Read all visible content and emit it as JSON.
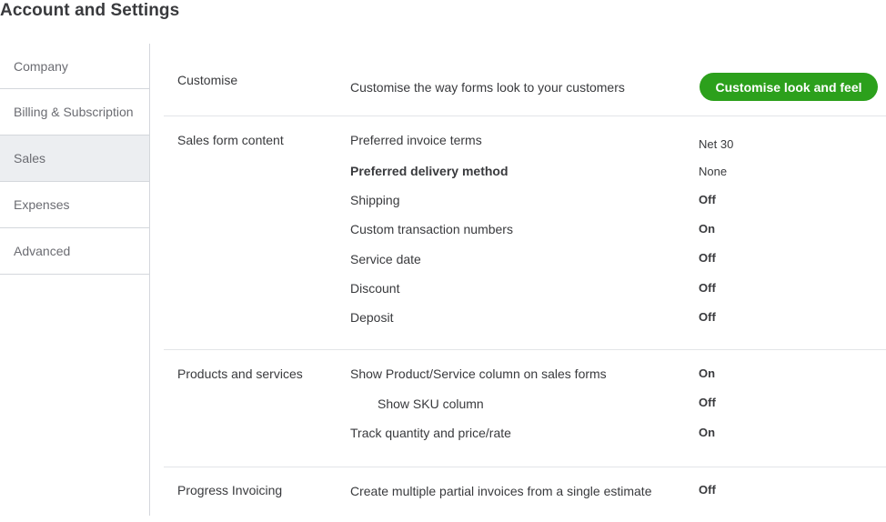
{
  "header": {
    "title": "Account and Settings"
  },
  "sidebar": {
    "items": [
      {
        "label": "Company"
      },
      {
        "label": "Billing & Subscription"
      },
      {
        "label": "Sales",
        "active": true
      },
      {
        "label": "Expenses"
      },
      {
        "label": "Advanced"
      }
    ]
  },
  "sections": {
    "customise": {
      "title": "Customise",
      "description": "Customise the way forms look to your customers",
      "button_label": "Customise look and feel",
      "button_color": "#2ca01c"
    },
    "sales_form_content": {
      "title": "Sales form content",
      "rows": [
        {
          "label": "Preferred invoice terms",
          "value": "Net 30"
        },
        {
          "label": "Preferred delivery method",
          "value": "None"
        },
        {
          "label": "Shipping",
          "value": "Off"
        },
        {
          "label": "Custom transaction numbers",
          "value": "On"
        },
        {
          "label": "Service date",
          "value": "Off"
        },
        {
          "label": "Discount",
          "value": "Off"
        },
        {
          "label": "Deposit",
          "value": "Off"
        }
      ]
    },
    "products_services": {
      "title": "Products and services",
      "rows": [
        {
          "label": "Show Product/Service column on sales forms",
          "value": "On"
        },
        {
          "label": "Show SKU column",
          "value": "Off"
        },
        {
          "label": "Track quantity and price/rate",
          "value": "On"
        }
      ]
    },
    "progress_invoicing": {
      "title": "Progress Invoicing",
      "rows": [
        {
          "label": "Create multiple partial invoices from a single estimate",
          "value": "Off"
        }
      ]
    }
  }
}
